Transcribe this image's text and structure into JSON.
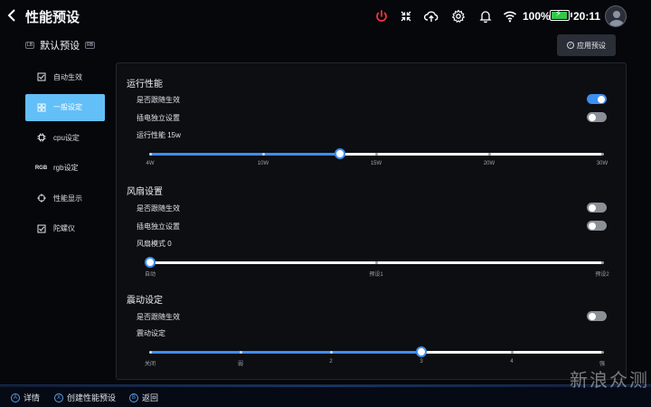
{
  "header": {
    "title": "性能预设",
    "battery_percent": "100%",
    "time": "20:11"
  },
  "icons": {
    "power": "power-icon",
    "fullscreen": "collapse-arrows-icon",
    "cloud": "cloud-upload-icon",
    "settings": "gear-icon",
    "notification": "bell-icon",
    "wifi": "wifi-icon",
    "battery": "battery-charging-icon"
  },
  "colors": {
    "accent": "#3d8ef0",
    "sidebar_active": "#63bff7",
    "power_icon": "#e8333f",
    "battery_fill": "#35c54c"
  },
  "preset": {
    "lb": "LB",
    "name": "默认预设",
    "rb": "RB",
    "apply_label": "应用预设"
  },
  "sidebar": {
    "items": [
      {
        "label": "自动生效",
        "icon": "checkbox-icon",
        "active": false
      },
      {
        "label": "一般设定",
        "icon": "grid-icon",
        "active": true
      },
      {
        "label": "cpu设定",
        "icon": "chip-icon",
        "active": false
      },
      {
        "label": "rgb设定",
        "icon": "RGB",
        "active": false
      },
      {
        "label": "性能显示",
        "icon": "crosshair-icon",
        "active": false
      },
      {
        "label": "陀螺仪",
        "icon": "checkbox-icon",
        "active": false
      }
    ]
  },
  "sections": {
    "performance": {
      "title": "运行性能",
      "follow_label": "是否跟随生效",
      "follow_on": true,
      "plug_label": "插电独立设置",
      "plug_on": false,
      "value_label": "运行性能",
      "value": "15w",
      "slider_value": 0.42,
      "ticks": [
        "4W",
        "10W",
        "15W",
        "20W",
        "30W"
      ]
    },
    "fan": {
      "title": "风扇设置",
      "follow_label": "是否跟随生效",
      "follow_on": false,
      "plug_label": "插电独立设置",
      "plug_on": false,
      "value_label": "风扇模式",
      "value": "0",
      "slider_value": 0.0,
      "ticks": [
        "自动",
        "预设1",
        "预设2"
      ]
    },
    "vibration": {
      "title": "震动设定",
      "follow_label": "是否跟随生效",
      "follow_on": false,
      "value_label": "震动设定",
      "slider_value": 0.6,
      "ticks": [
        "关闭",
        "弱",
        "2",
        "3",
        "4",
        "强"
      ]
    }
  },
  "bottombar": {
    "details": {
      "glyph": "A",
      "label": "详情"
    },
    "create": {
      "glyph": "X",
      "label": "创建性能预设"
    },
    "back": {
      "glyph": "B",
      "label": "返回"
    }
  },
  "watermark": "新浪众测"
}
